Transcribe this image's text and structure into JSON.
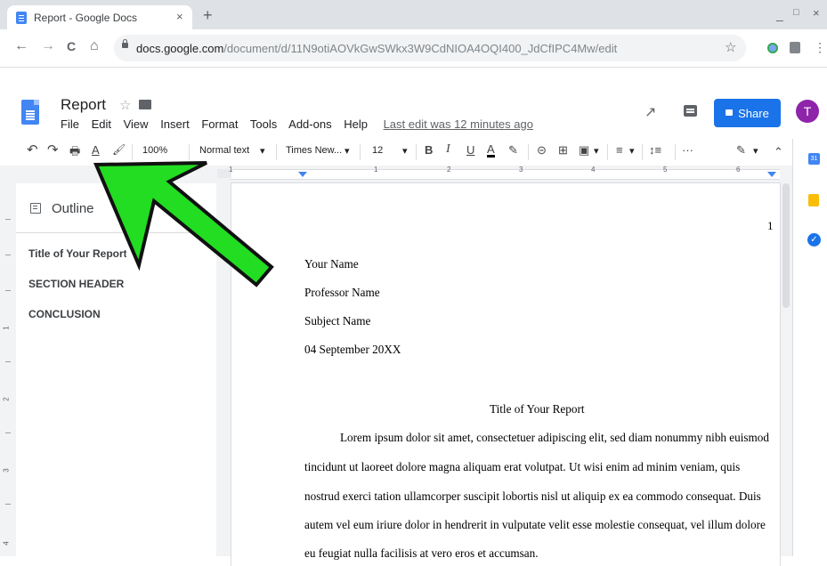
{
  "browser": {
    "tab_title": "Report - Google Docs",
    "tab_close": "×",
    "new_tab": "+",
    "win_min": "_",
    "win_max": "□",
    "win_close": "×",
    "nav": {
      "back": "←",
      "forward": "→",
      "reload": "C",
      "home": "⌂"
    },
    "url_host": "docs.google.com",
    "url_path": "/document/d/11N9otiAOVkGwSWkx3W9CdNIOA4OQI400_JdCfIPC4Mw/edit",
    "star": "☆",
    "menu": "⋮"
  },
  "docs": {
    "title": "Report",
    "star": "☆",
    "menus": [
      "File",
      "Edit",
      "View",
      "Insert",
      "Format",
      "Tools",
      "Add-ons",
      "Help"
    ],
    "last_edit": "Last edit was 12 minutes ago",
    "trend": "↗",
    "share_label": "Share",
    "avatar_letter": "T"
  },
  "toolbar": {
    "undo": "↶",
    "redo": "↷",
    "print": "🖶",
    "spell": "A",
    "paint": "🖌",
    "zoom": "100%",
    "style": "Normal text",
    "font": "Times New...",
    "size": "12",
    "bold": "B",
    "italic": "I",
    "underline": "U",
    "color": "A",
    "highlight": "✎",
    "link": "⊝",
    "comment": "⊞",
    "image": "▣",
    "align": "≡",
    "spacing": "↕≡",
    "more": "···",
    "edit_mode": "✎",
    "collapse": "⌃",
    "dropdown": "▾"
  },
  "ruler": {
    "labels": [
      "1",
      "1",
      "2",
      "3",
      "4",
      "5",
      "6"
    ]
  },
  "vruler": {
    "labels": [
      "1",
      "2",
      "3",
      "4"
    ]
  },
  "outline": {
    "title": "Outline",
    "collapse": "‹",
    "items": [
      "Title of Your Report",
      "SECTION HEADER",
      "CONCLUSION"
    ]
  },
  "document": {
    "page_number": "1",
    "header_lines": [
      "Your Name",
      "Professor Name",
      "Subject Name",
      "04 September 20XX"
    ],
    "report_title": "Title of Your Report",
    "body_lines": [
      "Lorem ipsum dolor sit amet, consectetuer adipiscing elit, sed diam nonummy nibh euismod",
      "tincidunt ut laoreet dolore magna aliquam erat volutpat. Ut wisi enim ad minim veniam, quis",
      "nostrud exerci tation ullamcorper suscipit lobortis nisl ut aliquip ex ea commodo consequat. Duis",
      "autem vel eum iriure dolor in hendrerit in vulputate velit esse molestie consequat, vel illum dolore",
      "eu feugiat nulla facilisis at vero eros et accumsan."
    ]
  },
  "side_panel": {
    "calendar": "31",
    "tasks": "✓"
  },
  "annotation": {
    "arrow_fill": "#22dd22",
    "arrow_stroke": "#111111"
  },
  "colors": {
    "brand_blue": "#1a73e8",
    "docs_blue": "#4285f4",
    "avatar": "#8e24aa"
  }
}
